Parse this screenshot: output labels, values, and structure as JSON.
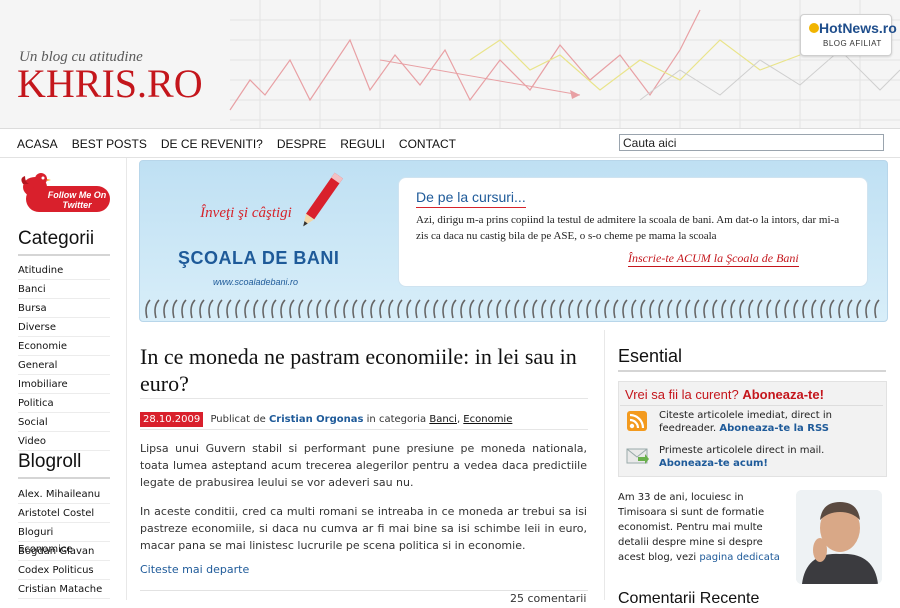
{
  "header": {
    "tagline": "Un blog cu atitudine",
    "logo": "KHRIS.RO",
    "badge_title": "HotNews.ro",
    "badge_sub": "BLOG AFILIAT"
  },
  "nav": {
    "items": [
      "ACASA",
      "BEST POSTS",
      "DE CE REVENITI?",
      "DESPRE",
      "REGULI",
      "CONTACT"
    ],
    "search_value": "Cauta aici"
  },
  "sidebar": {
    "twitter_label": "Follow Me On Twitter",
    "categories_title": "Categorii",
    "categories": [
      "Atitudine",
      "Banci",
      "Bursa",
      "Diverse",
      "Economie",
      "General",
      "Imobiliare",
      "Politica",
      "Social",
      "Video"
    ],
    "blogroll_title": "Blogroll",
    "blogroll": [
      "Alex. Mihaileanu",
      "Aristotel Costel",
      "Bloguri Economice",
      "Bogdan Glavan",
      "Codex Politicus",
      "Cristian Matache"
    ]
  },
  "banner": {
    "script": "Înveţi şi câştigi",
    "title": "ŞCOALA DE BANI",
    "url": "www.scoaladebani.ro",
    "card_title": "De pe la cursuri...",
    "card_text": "Azi, dirigu m-a prins copiind la testul de admitere la scoala de bani. Am dat-o la intors, dar mi-a zis ca daca nu castig bila de pe ASE, o s-o cheme pe mama la scoala",
    "card_cta": "Înscrie-te ACUM la Şcoala de Bani"
  },
  "article": {
    "title": "In ce moneda ne pastram economiile: in lei sau in euro?",
    "date": "28.10.2009",
    "published_by": "Publicat de",
    "author": "Cristian Orgonas",
    "in_category": "in categoria",
    "cat1": "Banci",
    "cat2": "Economie",
    "p1": "Lipsa unui Guvern stabil si performant pune presiune pe moneda nationala, toata lumea asteptand acum trecerea alegerilor pentru a vedea daca predictiile legate de prabusirea leului se vor adeveri sau nu.",
    "p2": "In aceste conditii, cred ca multi romani se intreaba in ce moneda ar trebui sa isi pastreze economiile, si daca nu cumva ar fi mai bine sa isi schimbe leii in euro, macar pana se mai linistesc lucrurile pe scena politica si in economie.",
    "read_more": "Citeste mai departe",
    "comments": "25 comentarii"
  },
  "right": {
    "esential_title": "Esential",
    "rss_head_a": "Vrei sa fii la curent?",
    "rss_head_b": "Aboneaza-te!",
    "rss_item1": "Citeste articolele imediat, direct in feedreader.",
    "rss_item1_link": "Aboneaza-te la RSS",
    "rss_item2": "Primeste articolele direct in mail.",
    "rss_item2_link": "Aboneaza-te acum!",
    "about_text": "Am 33 de ani, locuiesc in Timisoara si sunt de formatie economist. Pentru mai multe detalii despre mine si despre acest blog, vezi",
    "about_link": "pagina dedicata",
    "next_title": "Comentarii Recente"
  },
  "colors": {
    "brand_red": "#c4161c",
    "link_blue": "#1e5a99",
    "banner_blue": "#bfe0f3"
  }
}
